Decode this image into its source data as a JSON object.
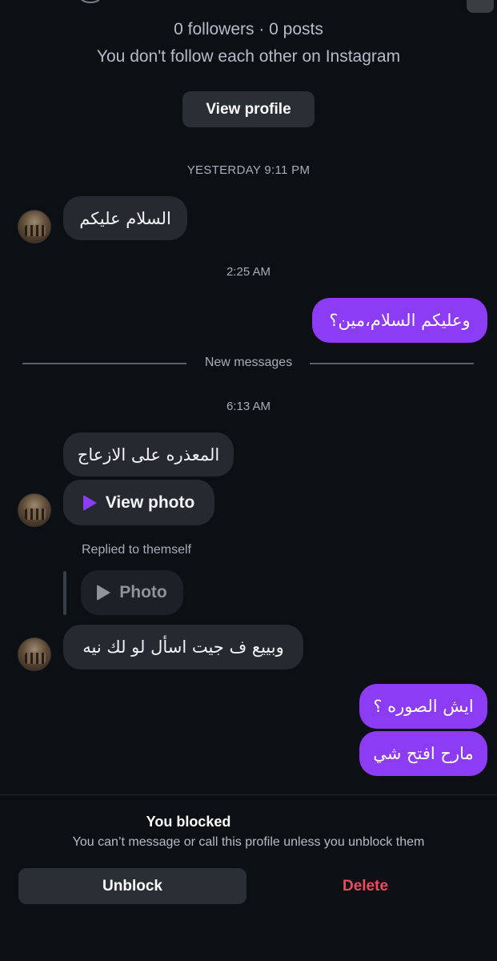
{
  "profile": {
    "stats": "0 followers · 0 posts",
    "follow_note": "You don't follow each other on Instagram",
    "view_profile_label": "View profile"
  },
  "thread": {
    "timestamps": [
      "YESTERDAY 9:11 PM",
      "2:25 AM",
      "6:13 AM"
    ],
    "new_messages_label": "New messages",
    "messages": [
      {
        "from": "them",
        "text": "السلام عليكم"
      },
      {
        "from": "me",
        "text": "وعليكم السلام،مين؟"
      },
      {
        "from": "them",
        "text": "المعذره على الازعاج"
      },
      {
        "from": "them",
        "text": "View photo"
      },
      {
        "from": "them",
        "text": "Photo"
      },
      {
        "from": "them",
        "text": "وبييع ف جيت اسأل لو لك نيه"
      },
      {
        "from": "me",
        "text": "ايش الصوره ؟"
      },
      {
        "from": "me",
        "text": "مارح افتح شي"
      }
    ],
    "reply_note": "Replied to themself"
  },
  "footer": {
    "blocked_title": "You blocked",
    "blocked_sub": "You can’t message or call this profile unless you unblock them",
    "unblock_label": "Unblock",
    "delete_label": "Delete"
  },
  "colors": {
    "background": "#0c0f14",
    "outgoing_bubble": "#8c3cf5",
    "incoming_bubble": "#262a30",
    "delete": "#ed4c5c"
  },
  "icons": {
    "play": "play-triangle-icon",
    "avatar": "profile-avatar"
  }
}
